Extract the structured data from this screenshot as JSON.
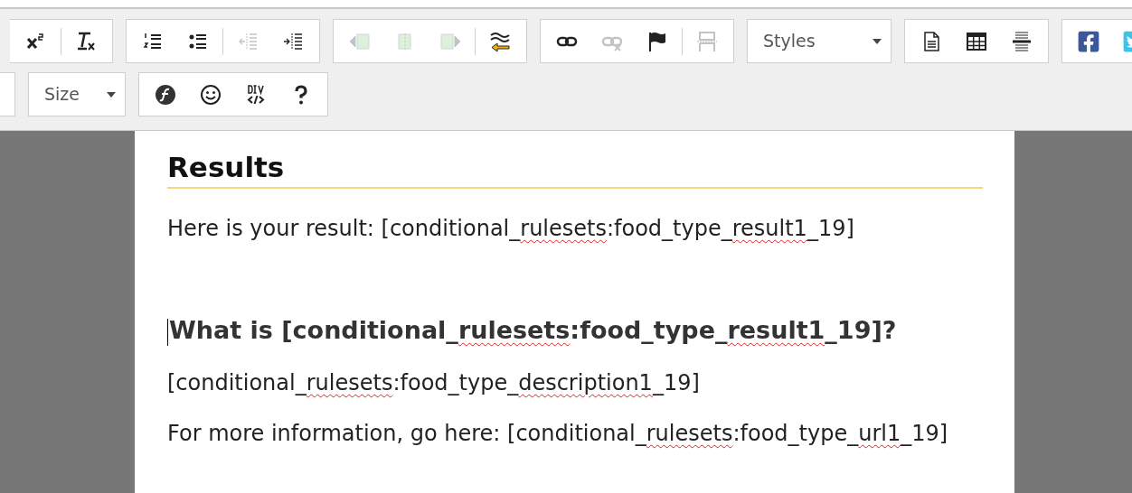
{
  "toolbar": {
    "rows": [
      {
        "groups": [
          {
            "kind": "buttons",
            "cut": true,
            "items": [
              {
                "kind": "superscript",
                "disabled": false
              },
              {
                "kind": "separator"
              },
              {
                "kind": "clear-format",
                "disabled": false
              }
            ]
          },
          {
            "kind": "buttons",
            "items": [
              {
                "kind": "numbered-list",
                "disabled": false
              },
              {
                "kind": "bulleted-list",
                "disabled": false
              },
              {
                "kind": "separator"
              },
              {
                "kind": "outdent",
                "disabled": true
              },
              {
                "kind": "indent",
                "disabled": false
              }
            ]
          },
          {
            "kind": "buttons",
            "items": [
              {
                "kind": "image-left",
                "disabled": true
              },
              {
                "kind": "image-center",
                "disabled": true
              },
              {
                "kind": "image-right",
                "disabled": true
              },
              {
                "kind": "separator"
              },
              {
                "kind": "wave-arrow",
                "disabled": false
              }
            ]
          },
          {
            "kind": "buttons",
            "items": [
              {
                "kind": "link",
                "disabled": false
              },
              {
                "kind": "unlink",
                "disabled": true
              },
              {
                "kind": "flag",
                "disabled": false
              },
              {
                "kind": "separator"
              },
              {
                "kind": "page-break",
                "disabled": true
              }
            ]
          },
          {
            "kind": "dropdown",
            "label": "Styles"
          },
          {
            "kind": "buttons",
            "items": [
              {
                "kind": "document",
                "disabled": false
              },
              {
                "kind": "table",
                "disabled": false
              },
              {
                "kind": "horizontal-rule",
                "disabled": false
              }
            ]
          },
          {
            "kind": "buttons",
            "items": [
              {
                "kind": "facebook",
                "disabled": false
              },
              {
                "kind": "twitter",
                "disabled": false
              }
            ]
          }
        ]
      },
      {
        "groups": [
          {
            "kind": "stub"
          },
          {
            "kind": "dropdown",
            "label": "Size"
          },
          {
            "kind": "buttons",
            "items": [
              {
                "kind": "flash",
                "disabled": false
              },
              {
                "kind": "smiley",
                "disabled": false
              },
              {
                "kind": "div",
                "disabled": false
              },
              {
                "kind": "help",
                "disabled": false
              }
            ]
          }
        ]
      }
    ]
  },
  "document": {
    "blocks": [
      {
        "kind": "heading",
        "caret": false,
        "segments": [
          {
            "text": "Results",
            "misspelled": false
          }
        ]
      },
      {
        "kind": "paragraph",
        "caret": false,
        "segments": [
          {
            "text": "Here is your result: [conditional_",
            "misspelled": false
          },
          {
            "text": "rulesets",
            "misspelled": true
          },
          {
            "text": ":food_type_",
            "misspelled": false
          },
          {
            "text": "result1",
            "misspelled": true
          },
          {
            "text": "_19]",
            "misspelled": false
          }
        ]
      },
      {
        "kind": "empty"
      },
      {
        "kind": "subheading",
        "caret": true,
        "segments": [
          {
            "text": "What is [conditional_",
            "misspelled": false
          },
          {
            "text": "rulesets",
            "misspelled": true
          },
          {
            "text": ":food_type_",
            "misspelled": false
          },
          {
            "text": "result1",
            "misspelled": true
          },
          {
            "text": "_19]?",
            "misspelled": false
          }
        ]
      },
      {
        "kind": "paragraph",
        "caret": false,
        "segments": [
          {
            "text": "[conditional_",
            "misspelled": false
          },
          {
            "text": "rulesets",
            "misspelled": true
          },
          {
            "text": ":food_type_",
            "misspelled": false
          },
          {
            "text": "description1",
            "misspelled": true
          },
          {
            "text": "_19]",
            "misspelled": false
          }
        ]
      },
      {
        "kind": "paragraph",
        "caret": false,
        "segments": [
          {
            "text": "For more information, go here: [conditional_",
            "misspelled": false
          },
          {
            "text": "rulesets",
            "misspelled": true
          },
          {
            "text": ":food_type_",
            "misspelled": false
          },
          {
            "text": "url1",
            "misspelled": true
          },
          {
            "text": "_19]",
            "misspelled": false
          }
        ]
      }
    ]
  }
}
